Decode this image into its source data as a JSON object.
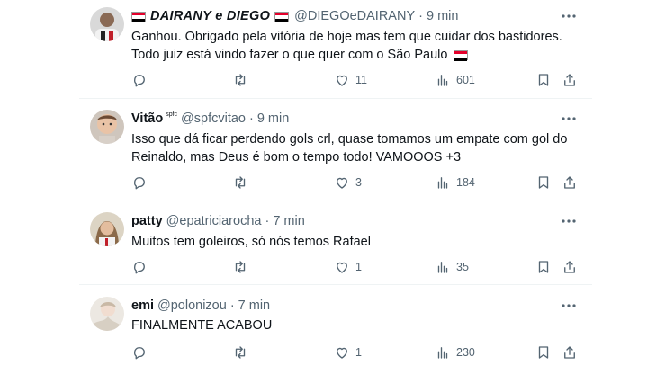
{
  "tweets": [
    {
      "name": "DAIRANY e DIEGO",
      "handle": "@DIEGOeDAIRANY",
      "dot": "·",
      "time": "9 min",
      "line1": "Ganhou. Obrigado pela vitória de hoje mas tem que cuidar dos bastidores.",
      "line2": "Todo juiz está vindo fazer o que quer com o São Paulo",
      "likes": "11",
      "views": "601"
    },
    {
      "name": "Vitão",
      "name_tag": "spfc",
      "handle": "@spfcvitao",
      "dot": "·",
      "time": "9 min",
      "line1": "Isso que dá ficar perdendo gols crl, quase tomamos um empate com gol do",
      "line2": "Reinaldo, mas Deus é bom o tempo todo! VAMOOOS +3",
      "likes": "3",
      "views": "184"
    },
    {
      "name": "patty",
      "handle": "@epatriciarocha",
      "dot": "·",
      "time": "7 min",
      "line1": "Muitos tem goleiros, só nós temos Rafael",
      "likes": "1",
      "views": "35"
    },
    {
      "name": "emi",
      "handle": "@polonizou",
      "dot": "·",
      "time": "7 min",
      "line1": "FINALMENTE ACABOU",
      "likes": "1",
      "views": "230"
    }
  ],
  "colors": {
    "text": "#0f1419",
    "muted": "#536471",
    "divider": "#eff3f4",
    "flag_red": "#e4002b",
    "flag_white": "#ffffff",
    "flag_black": "#000000"
  },
  "icons": [
    "reply-icon",
    "retweet-icon",
    "like-icon",
    "views-icon",
    "bookmark-icon",
    "share-icon",
    "more-icon",
    "sao-paulo-flag-icon"
  ]
}
